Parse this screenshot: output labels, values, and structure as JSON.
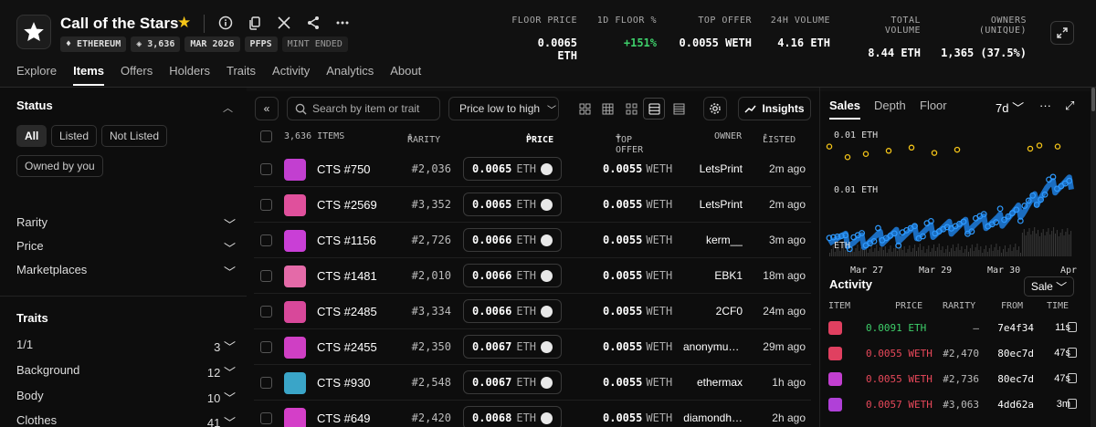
{
  "collection": {
    "name": "Call of the Stars",
    "chips": [
      "ETHEREUM",
      "3,636",
      "MAR 2026",
      "PFPS",
      "MINT ENDED"
    ]
  },
  "stats": [
    {
      "label": "FLOOR PRICE",
      "value": "0.0065 ETH"
    },
    {
      "label": "1D FLOOR %",
      "value": "+151%",
      "color": "#3ecf6a"
    },
    {
      "label": "TOP OFFER",
      "value": "0.0055 WETH"
    },
    {
      "label": "24H VOLUME",
      "value": "4.16 ETH"
    },
    {
      "label": "TOTAL VOLUME",
      "value": "8.44 ETH"
    },
    {
      "label": "OWNERS (UNIQUE)",
      "value": "1,365 (37.5%)"
    }
  ],
  "tabs": [
    "Explore",
    "Items",
    "Offers",
    "Holders",
    "Traits",
    "Activity",
    "Analytics",
    "About"
  ],
  "active_tab": "Items",
  "sidebar": {
    "status_title": "Status",
    "status_options": [
      "All",
      "Listed",
      "Not Listed",
      "Owned by you"
    ],
    "filters": [
      "Rarity",
      "Price",
      "Marketplaces"
    ],
    "traits_title": "Traits",
    "traits": [
      {
        "name": "1/1",
        "count": "3"
      },
      {
        "name": "Background",
        "count": "12"
      },
      {
        "name": "Body",
        "count": "10"
      },
      {
        "name": "Clothes",
        "count": "41"
      }
    ]
  },
  "toolbar": {
    "search_placeholder": "Search by item or trait",
    "sort_label": "Price low to high",
    "insights_label": "Insights"
  },
  "table": {
    "columns": {
      "items": "3,636 ITEMS",
      "rarity": "RARITY",
      "price": "PRICE",
      "top_offer": "TOP OFFER",
      "owner": "OWNER",
      "listed": "LISTED"
    },
    "rows": [
      {
        "name": "CTS #750",
        "rarity": "#2,036",
        "price": "0.0065",
        "price_unit": "ETH",
        "offer": "0.0055",
        "offer_unit": "WETH",
        "owner": "LetsPrint",
        "listed": "2m ago",
        "thumb": "#c23fd0"
      },
      {
        "name": "CTS #2569",
        "rarity": "#3,352",
        "price": "0.0065",
        "price_unit": "ETH",
        "offer": "0.0055",
        "offer_unit": "WETH",
        "owner": "LetsPrint",
        "listed": "2m ago",
        "thumb": "#e0509c"
      },
      {
        "name": "CTS #1156",
        "rarity": "#2,726",
        "price": "0.0066",
        "price_unit": "ETH",
        "offer": "0.0055",
        "offer_unit": "WETH",
        "owner": "kerm__",
        "listed": "3m ago",
        "thumb": "#c93fd6"
      },
      {
        "name": "CTS #1481",
        "rarity": "#2,010",
        "price": "0.0066",
        "price_unit": "ETH",
        "offer": "0.0055",
        "offer_unit": "WETH",
        "owner": "EBK1",
        "listed": "18m ago",
        "thumb": "#e46aa8"
      },
      {
        "name": "CTS #2485",
        "rarity": "#3,334",
        "price": "0.0066",
        "price_unit": "ETH",
        "offer": "0.0055",
        "offer_unit": "WETH",
        "owner": "2CF0",
        "listed": "24m ago",
        "thumb": "#d8489a"
      },
      {
        "name": "CTS #2455",
        "rarity": "#2,350",
        "price": "0.0067",
        "price_unit": "ETH",
        "offer": "0.0055",
        "offer_unit": "WETH",
        "owner": "anonymus…",
        "listed": "29m ago",
        "thumb": "#cf3fc4"
      },
      {
        "name": "CTS #930",
        "rarity": "#2,548",
        "price": "0.0067",
        "price_unit": "ETH",
        "offer": "0.0055",
        "offer_unit": "WETH",
        "owner": "ethermax",
        "listed": "1h ago",
        "thumb": "#3aa5c8"
      },
      {
        "name": "CTS #649",
        "rarity": "#2,420",
        "price": "0.0068",
        "price_unit": "ETH",
        "offer": "0.0055",
        "offer_unit": "WETH",
        "owner": "diamondh…",
        "listed": "2h ago",
        "thumb": "#d43fc8"
      }
    ]
  },
  "right_panel": {
    "tabs": [
      "Sales",
      "Depth",
      "Floor"
    ],
    "active_tab": "Sales",
    "range": "7d",
    "activity_title": "Activity",
    "activity_filter": "Sale",
    "activity_columns": [
      "ITEM",
      "PRICE",
      "RARITY",
      "FROM",
      "TIME"
    ],
    "activity_rows": [
      {
        "price": "0.0091 ETH",
        "rarity": "–",
        "from": "7e4f34",
        "time": "11s",
        "color": "#3ecf6a",
        "thumb": "#e04060"
      },
      {
        "price": "0.0055 WETH",
        "rarity": "#2,470",
        "from": "80ec7d",
        "time": "47s",
        "color": "#e8485a",
        "thumb": "#e04060"
      },
      {
        "price": "0.0055 WETH",
        "rarity": "#2,736",
        "from": "80ec7d",
        "time": "47s",
        "color": "#e8485a",
        "thumb": "#c23fd0"
      },
      {
        "price": "0.0057 WETH",
        "rarity": "#3,063",
        "from": "4dd62a",
        "time": "3m",
        "color": "#e8485a",
        "thumb": "#b040d8"
      }
    ]
  },
  "chart_data": {
    "type": "scatter",
    "title": "",
    "y_tick_labels": [
      "0.01 ETH",
      "0.01 ETH",
      "ETH"
    ],
    "x_tick_labels": [
      "Mar 27",
      "Mar 29",
      "Mar 30",
      "Apr"
    ],
    "series": [
      {
        "values": [
          0.0125,
          0.0115,
          0.0118,
          0.0121,
          0.0124,
          0.0119,
          0.0122,
          0.0123,
          0.0126,
          0.0125
        ],
        "color": "#f5c518"
      },
      {
        "values": [
          0.004,
          0.0035,
          0.0038,
          0.0042,
          0.0045,
          0.0048,
          0.0052,
          0.0055,
          0.0065,
          0.0085,
          0.0091
        ],
        "color": "#2f9bff"
      }
    ]
  }
}
